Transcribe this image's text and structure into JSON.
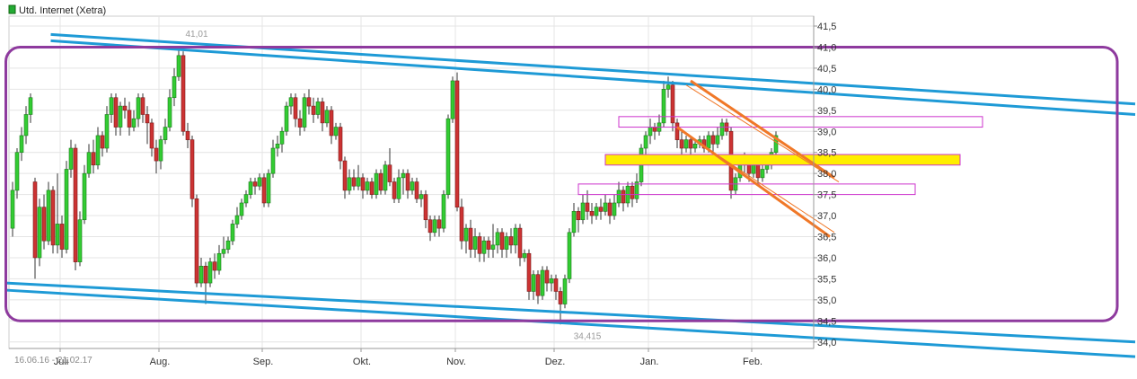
{
  "chart_data": {
    "type": "candlestick",
    "legend": {
      "label": "Utd. Internet (Xetra)",
      "color": "#22aa33",
      "placement": "top-left"
    },
    "date_range_label": "16.06.16 - 21.02.17",
    "ylim": [
      33.8,
      41.7
    ],
    "y_ticks": [
      "41,5",
      "41,0",
      "40,5",
      "40,0",
      "39,5",
      "39,0",
      "38,5",
      "38,0",
      "37,5",
      "37,0",
      "36,5",
      "36,0",
      "35,5",
      "35,0",
      "34,5",
      "34,0"
    ],
    "y_tick_values": [
      41.5,
      41.0,
      40.5,
      40.0,
      39.5,
      39.0,
      38.5,
      38.0,
      37.5,
      37.0,
      36.5,
      36.0,
      35.5,
      35.0,
      34.5,
      34.0
    ],
    "x_range": [
      0,
      178
    ],
    "x_ticks": [
      {
        "label": "Juli",
        "x": 11
      },
      {
        "label": "Aug.",
        "x": 33
      },
      {
        "label": "Sep.",
        "x": 56
      },
      {
        "label": "Okt.",
        "x": 78
      },
      {
        "label": "Nov.",
        "x": 99
      },
      {
        "label": "Dez.",
        "x": 121
      },
      {
        "label": "Jan.",
        "x": 142
      },
      {
        "label": "Feb.",
        "x": 165
      }
    ],
    "grid": true,
    "colors": {
      "up": "#33cc33",
      "down": "#cc3333",
      "wick": "#333333",
      "channel": "#1e9ad6",
      "downtrend": "#f07828",
      "resistance": "#ffee00",
      "zone": "#cc33cc",
      "frame": "#8e3a9e"
    },
    "extremes": [
      {
        "label": "41,01",
        "x": 41,
        "y": 41.01
      },
      {
        "label": "34,415",
        "x": 128,
        "y": 34.415
      }
    ],
    "candles": [
      [
        36.7,
        37.6,
        37.8,
        36.5
      ],
      [
        37.6,
        38.5,
        38.6,
        37.4
      ],
      [
        38.5,
        38.9,
        39.1,
        38.3
      ],
      [
        38.9,
        39.4,
        39.6,
        38.7
      ],
      [
        39.4,
        39.8,
        39.9,
        39.2
      ],
      [
        37.8,
        36.0,
        37.9,
        35.5
      ],
      [
        36.0,
        37.2,
        37.4,
        35.8
      ],
      [
        37.2,
        36.4,
        37.5,
        36.2
      ],
      [
        36.4,
        37.6,
        37.8,
        36.3
      ],
      [
        37.6,
        36.3,
        37.7,
        36.1
      ],
      [
        36.3,
        36.8,
        38.0,
        36.1
      ],
      [
        36.8,
        36.2,
        37.0,
        36.0
      ],
      [
        36.2,
        38.1,
        38.3,
        36.1
      ],
      [
        38.1,
        38.6,
        38.8,
        37.9
      ],
      [
        38.6,
        35.9,
        38.7,
        35.7
      ],
      [
        35.9,
        36.9,
        37.1,
        35.8
      ],
      [
        36.9,
        38.0,
        38.2,
        36.8
      ],
      [
        38.0,
        38.5,
        38.7,
        37.9
      ],
      [
        38.5,
        38.2,
        38.8,
        38.0
      ],
      [
        38.2,
        38.9,
        39.1,
        38.1
      ],
      [
        38.9,
        38.6,
        39.0,
        38.4
      ],
      [
        38.6,
        39.4,
        39.6,
        38.5
      ],
      [
        39.4,
        39.8,
        39.9,
        39.2
      ],
      [
        39.8,
        39.1,
        39.9,
        38.9
      ],
      [
        39.1,
        39.6,
        39.7,
        38.9
      ],
      [
        39.6,
        39.5,
        39.8,
        39.3
      ],
      [
        39.5,
        39.1,
        39.7,
        38.9
      ],
      [
        39.1,
        39.3,
        39.5,
        39.0
      ],
      [
        39.3,
        39.8,
        39.9,
        39.1
      ],
      [
        39.8,
        39.4,
        39.9,
        39.2
      ],
      [
        39.4,
        39.2,
        39.6,
        38.7
      ],
      [
        39.2,
        38.6,
        39.3,
        38.4
      ],
      [
        38.6,
        38.3,
        38.8,
        38.0
      ],
      [
        38.3,
        38.8,
        38.9,
        38.1
      ],
      [
        38.8,
        39.1,
        39.3,
        38.7
      ],
      [
        39.1,
        39.8,
        40.0,
        39.0
      ],
      [
        39.8,
        40.3,
        40.5,
        39.6
      ],
      [
        40.3,
        40.8,
        41.01,
        40.2
      ],
      [
        40.8,
        39.0,
        40.9,
        38.9
      ],
      [
        39.0,
        38.8,
        39.2,
        38.6
      ],
      [
        38.8,
        37.4,
        38.9,
        37.2
      ],
      [
        37.4,
        35.4,
        37.5,
        35.3
      ],
      [
        35.4,
        35.8,
        36.0,
        35.3
      ],
      [
        35.8,
        35.4,
        35.9,
        34.9
      ],
      [
        35.4,
        35.9,
        36.0,
        35.3
      ],
      [
        35.9,
        35.7,
        36.1,
        35.5
      ],
      [
        35.7,
        36.1,
        36.3,
        35.6
      ],
      [
        36.1,
        36.2,
        36.5,
        36.0
      ],
      [
        36.2,
        36.4,
        36.5,
        36.1
      ],
      [
        36.4,
        36.8,
        36.9,
        36.3
      ],
      [
        36.8,
        37.0,
        37.2,
        36.7
      ],
      [
        37.0,
        37.3,
        37.4,
        36.9
      ],
      [
        37.3,
        37.5,
        37.6,
        37.2
      ],
      [
        37.5,
        37.8,
        37.9,
        37.4
      ],
      [
        37.8,
        37.7,
        37.9,
        37.5
      ],
      [
        37.7,
        37.9,
        38.0,
        37.6
      ],
      [
        37.9,
        37.3,
        38.0,
        37.2
      ],
      [
        37.3,
        38.0,
        38.1,
        37.2
      ],
      [
        38.0,
        38.6,
        38.8,
        37.9
      ],
      [
        38.6,
        38.7,
        38.9,
        38.4
      ],
      [
        38.7,
        39.0,
        39.1,
        38.5
      ],
      [
        39.0,
        39.6,
        39.7,
        38.9
      ],
      [
        39.6,
        39.8,
        39.9,
        39.4
      ],
      [
        39.8,
        39.3,
        39.9,
        39.1
      ],
      [
        39.3,
        39.1,
        39.5,
        38.9
      ],
      [
        39.1,
        39.8,
        39.9,
        39.0
      ],
      [
        39.8,
        39.6,
        40.0,
        39.4
      ],
      [
        39.6,
        39.4,
        39.8,
        39.2
      ],
      [
        39.4,
        39.7,
        39.8,
        39.3
      ],
      [
        39.7,
        39.2,
        39.8,
        39.0
      ],
      [
        39.2,
        39.5,
        39.6,
        39.1
      ],
      [
        39.5,
        38.9,
        39.6,
        38.7
      ],
      [
        38.9,
        39.1,
        39.2,
        38.8
      ],
      [
        39.1,
        38.3,
        39.2,
        38.1
      ],
      [
        38.3,
        37.6,
        38.4,
        37.4
      ],
      [
        37.6,
        37.9,
        38.1,
        37.5
      ],
      [
        37.9,
        37.7,
        38.1,
        37.6
      ],
      [
        37.7,
        37.9,
        38.2,
        37.6
      ],
      [
        37.9,
        37.6,
        38.0,
        37.4
      ],
      [
        37.6,
        37.8,
        37.9,
        37.5
      ],
      [
        37.8,
        37.5,
        37.9,
        37.4
      ],
      [
        37.5,
        38.0,
        38.1,
        37.4
      ],
      [
        38.0,
        37.6,
        38.1,
        37.5
      ],
      [
        37.6,
        38.2,
        38.3,
        37.5
      ],
      [
        38.2,
        37.8,
        38.6,
        37.7
      ],
      [
        37.8,
        37.4,
        37.9,
        37.3
      ],
      [
        37.4,
        37.9,
        38.1,
        37.3
      ],
      [
        37.9,
        38.0,
        38.1,
        37.5
      ],
      [
        38.0,
        37.6,
        38.1,
        37.4
      ],
      [
        37.6,
        37.8,
        37.9,
        37.5
      ],
      [
        37.8,
        37.4,
        37.9,
        37.3
      ],
      [
        37.4,
        37.5,
        37.6,
        37.2
      ],
      [
        37.5,
        36.9,
        37.6,
        36.7
      ],
      [
        36.9,
        36.6,
        37.0,
        36.4
      ],
      [
        36.6,
        36.9,
        37.0,
        36.5
      ],
      [
        36.9,
        36.7,
        37.0,
        36.5
      ],
      [
        36.7,
        37.5,
        37.6,
        36.6
      ],
      [
        37.5,
        39.3,
        39.4,
        37.4
      ],
      [
        39.3,
        40.2,
        40.3,
        39.2
      ],
      [
        40.2,
        37.2,
        40.4,
        37.1
      ],
      [
        37.2,
        36.4,
        37.4,
        36.2
      ],
      [
        36.4,
        36.7,
        36.8,
        36.1
      ],
      [
        36.7,
        36.2,
        36.9,
        36.0
      ],
      [
        36.2,
        36.5,
        36.7,
        36.0
      ],
      [
        36.5,
        36.1,
        36.6,
        35.9
      ],
      [
        36.1,
        36.4,
        36.5,
        35.9
      ],
      [
        36.4,
        36.2,
        36.5,
        36.0
      ],
      [
        36.2,
        36.3,
        36.8,
        36.0
      ],
      [
        36.3,
        36.6,
        36.7,
        36.1
      ],
      [
        36.6,
        36.2,
        36.7,
        36.0
      ],
      [
        36.2,
        36.5,
        36.6,
        36.0
      ],
      [
        36.5,
        36.3,
        36.7,
        36.1
      ],
      [
        36.3,
        36.7,
        36.8,
        36.1
      ],
      [
        36.7,
        36.0,
        36.8,
        35.8
      ],
      [
        36.0,
        36.1,
        36.2,
        35.9
      ],
      [
        36.1,
        35.2,
        36.2,
        35.0
      ],
      [
        35.2,
        35.6,
        35.7,
        35.0
      ],
      [
        35.6,
        35.1,
        35.7,
        34.9
      ],
      [
        35.1,
        35.7,
        35.8,
        35.0
      ],
      [
        35.7,
        35.4,
        35.8,
        35.2
      ],
      [
        35.4,
        35.5,
        35.6,
        35.2
      ],
      [
        35.5,
        35.2,
        35.6,
        35.0
      ],
      [
        35.2,
        34.9,
        35.3,
        34.415
      ],
      [
        34.9,
        35.5,
        35.6,
        34.8
      ],
      [
        35.5,
        36.6,
        36.7,
        35.4
      ],
      [
        36.6,
        37.1,
        37.3,
        36.5
      ],
      [
        37.1,
        36.9,
        37.2,
        36.6
      ],
      [
        36.9,
        37.3,
        37.5,
        36.8
      ],
      [
        37.3,
        37.1,
        37.6,
        36.9
      ],
      [
        37.1,
        37.0,
        37.3,
        36.8
      ],
      [
        37.0,
        37.2,
        37.3,
        36.9
      ],
      [
        37.2,
        37.1,
        37.4,
        36.9
      ],
      [
        37.1,
        37.3,
        37.5,
        37.0
      ],
      [
        37.3,
        37.0,
        37.4,
        36.8
      ],
      [
        37.0,
        37.3,
        37.5,
        36.9
      ],
      [
        37.3,
        37.6,
        37.8,
        37.2
      ],
      [
        37.6,
        37.3,
        37.7,
        37.1
      ],
      [
        37.3,
        37.7,
        37.8,
        37.2
      ],
      [
        37.7,
        37.4,
        37.8,
        37.2
      ],
      [
        37.4,
        37.8,
        38.0,
        37.3
      ],
      [
        37.8,
        38.6,
        38.7,
        37.7
      ],
      [
        38.6,
        38.9,
        39.0,
        38.4
      ],
      [
        38.9,
        39.1,
        39.3,
        38.7
      ],
      [
        39.1,
        39.0,
        39.2,
        38.8
      ],
      [
        39.0,
        39.2,
        39.4,
        38.9
      ],
      [
        39.2,
        40.0,
        40.2,
        39.1
      ],
      [
        40.0,
        40.1,
        40.3,
        39.8
      ],
      [
        40.1,
        39.2,
        40.2,
        39.0
      ],
      [
        39.2,
        38.8,
        39.3,
        38.6
      ],
      [
        38.8,
        38.6,
        39.0,
        38.4
      ],
      [
        38.6,
        38.8,
        38.9,
        38.5
      ],
      [
        38.8,
        38.6,
        38.9,
        38.4
      ],
      [
        38.6,
        38.7,
        38.8,
        38.5
      ],
      [
        38.7,
        38.8,
        38.9,
        38.6
      ],
      [
        38.8,
        38.6,
        38.9,
        38.5
      ],
      [
        38.6,
        38.9,
        39.0,
        38.5
      ],
      [
        38.9,
        38.7,
        39.0,
        38.5
      ],
      [
        38.7,
        38.9,
        39.1,
        38.6
      ],
      [
        38.9,
        39.2,
        39.3,
        38.8
      ],
      [
        39.2,
        39.0,
        39.3,
        38.9
      ],
      [
        39.0,
        37.6,
        39.1,
        37.4
      ],
      [
        37.6,
        37.9,
        38.0,
        37.5
      ],
      [
        37.9,
        38.3,
        38.4,
        37.8
      ],
      [
        38.3,
        38.2,
        38.5,
        38.0
      ],
      [
        38.2,
        38.0,
        38.3,
        37.8
      ],
      [
        38.0,
        38.2,
        38.3,
        37.9
      ],
      [
        38.2,
        37.9,
        38.3,
        37.7
      ],
      [
        37.9,
        38.1,
        38.2,
        37.8
      ],
      [
        38.1,
        38.2,
        38.3,
        38.0
      ],
      [
        38.2,
        38.5,
        38.6,
        38.1
      ],
      [
        38.5,
        38.9,
        39.0,
        38.4
      ]
    ],
    "annotations": {
      "frame": {
        "x0": -1.5,
        "x1": 246,
        "y0": 41.0,
        "y1": 34.5
      },
      "channel_lines": [
        {
          "x0": 8.5,
          "y0": 41.3,
          "x1": 250,
          "y1": 39.65
        },
        {
          "x0": 8.5,
          "y0": 41.15,
          "x1": 250,
          "y1": 39.4
        },
        {
          "x0": -1.5,
          "y0": 35.4,
          "x1": 250,
          "y1": 34.0
        },
        {
          "x0": -1.5,
          "y0": 35.23,
          "x1": 250,
          "y1": 33.65
        }
      ],
      "downtrend_lines": [
        {
          "x0": 151,
          "y0": 40.2,
          "x1": 183,
          "y1": 37.9,
          "width": 3
        },
        {
          "x0": 148,
          "y0": 39.1,
          "x1": 182,
          "y1": 36.5,
          "width": 3
        },
        {
          "x0": 150,
          "y0": 40.1,
          "x1": 184,
          "y1": 37.8,
          "width": 1
        },
        {
          "x0": 149,
          "y0": 39.0,
          "x1": 183,
          "y1": 36.6,
          "width": 1
        }
      ],
      "resistance_band": {
        "x0": 132,
        "x1": 211,
        "y0": 38.45,
        "y1": 38.2
      },
      "zones": [
        {
          "x0": 135,
          "x1": 216,
          "y0": 39.35,
          "y1": 39.1
        },
        {
          "x0": 126,
          "x1": 201,
          "y0": 37.75,
          "y1": 37.5
        }
      ]
    }
  }
}
